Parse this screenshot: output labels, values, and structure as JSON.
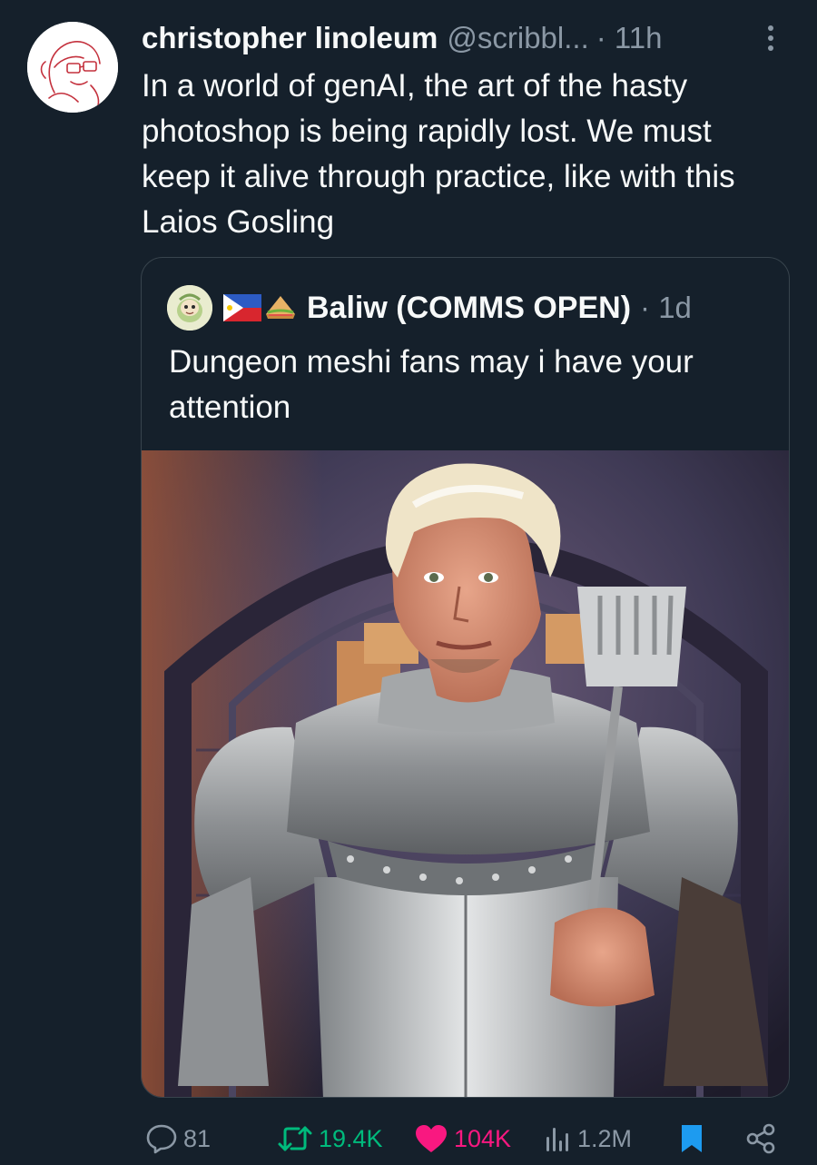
{
  "tweet": {
    "display_name": "christopher linoleum",
    "handle": "@scribbl...",
    "time": "· 11h",
    "text": "In a world of genAI, the art of the hasty photoshop is being rapidly lost. We must keep it alive through practice, like with this Laios Gosling"
  },
  "quote": {
    "display_name": "Baliw (COMMS OPEN)",
    "time": "· 1d",
    "text": "Dungeon meshi fans may i have your attention",
    "image_subject": "photoshopped-knight-in-armor"
  },
  "actions": {
    "replies": "81",
    "retweets": "19.4K",
    "likes": "104K",
    "views": "1.2M"
  },
  "colors": {
    "background": "#15202b",
    "text": "#f7f9f9",
    "muted": "#8b98a5",
    "retweet": "#00ba7c",
    "like": "#f91880",
    "bookmark": "#1d9bf0"
  }
}
